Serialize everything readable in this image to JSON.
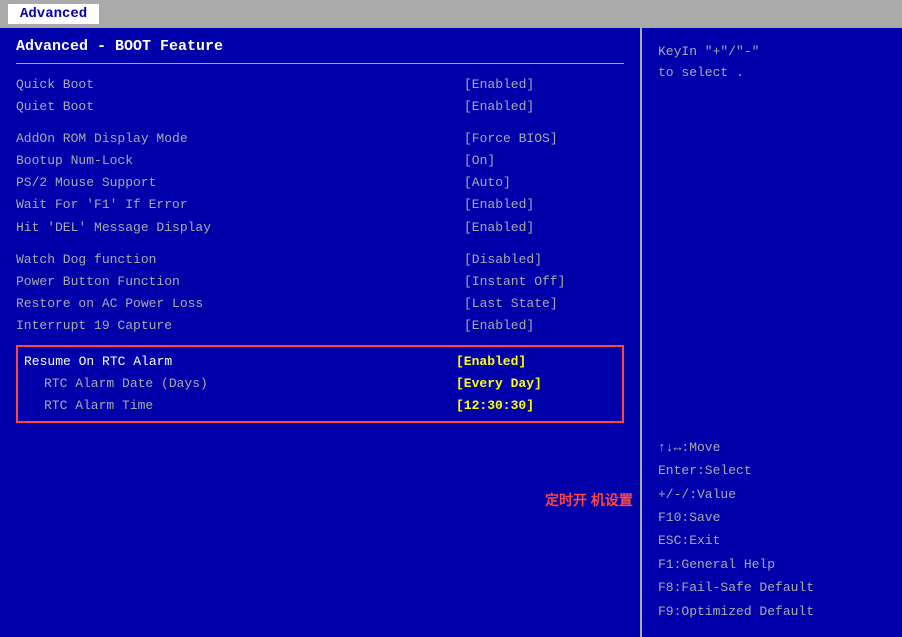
{
  "topbar": {
    "items": [
      {
        "label": "Advanced",
        "active": true
      }
    ]
  },
  "left": {
    "title": "Advanced - BOOT Feature",
    "items": [
      {
        "label": "Quick Boot",
        "value": "[Enabled]",
        "indent": false
      },
      {
        "label": "Quiet Boot",
        "value": "[Enabled]",
        "indent": false
      },
      {
        "label": "",
        "value": "",
        "spacer": true
      },
      {
        "label": "AddOn ROM Display Mode",
        "value": "[Force BIOS]",
        "indent": false
      },
      {
        "label": "Bootup Num-Lock",
        "value": "[On]",
        "indent": false
      },
      {
        "label": "PS/2 Mouse Support",
        "value": "[Auto]",
        "indent": false
      },
      {
        "label": "Wait For 'F1' If Error",
        "value": "[Enabled]",
        "indent": false
      },
      {
        "label": "Hit 'DEL' Message Display",
        "value": "[Enabled]",
        "indent": false
      },
      {
        "label": "",
        "value": "",
        "spacer": true
      },
      {
        "label": "Watch Dog function",
        "value": "[Disabled]",
        "indent": false
      },
      {
        "label": "Power Button Function",
        "value": "[Instant Off]",
        "indent": false
      },
      {
        "label": "Restore on AC Power Loss",
        "value": "[Last State]",
        "indent": false
      },
      {
        "label": "Interrupt 19 Capture",
        "value": "[Enabled]",
        "indent": false
      }
    ],
    "highlight_items": [
      {
        "label": "Resume On RTC Alarm",
        "value": "[Enabled]",
        "selected": true,
        "indent": false
      },
      {
        "label": "RTC Alarm Date (Days)",
        "value": "[Every Day]",
        "selected": false,
        "sub": true
      },
      {
        "label": "RTC Alarm Time",
        "value": "[12:30:30]",
        "selected": false,
        "sub": true
      }
    ],
    "chinese_label": "定时开\n机设置"
  },
  "right": {
    "help_text": "KeyIn \"+\"/\"-\"\nto select .",
    "nav_keys": [
      "↑↓↔:Move",
      "Enter:Select",
      "+/-/:Value",
      "F10:Save",
      "ESC:Exit",
      "F1:General Help",
      "F8:Fail-Safe Default",
      "F9:Optimized Default"
    ]
  }
}
